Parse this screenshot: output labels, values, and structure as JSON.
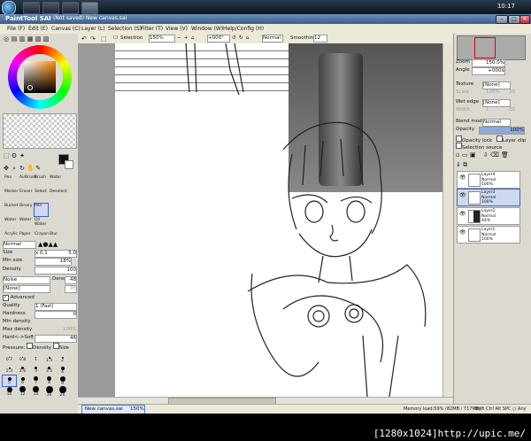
{
  "taskbar": {
    "clock": "10:17"
  },
  "window": {
    "app_title": "PaintTool SAI",
    "doc_title": "(Not saved) New canvas.sai"
  },
  "menu": [
    "File (F)",
    "Edit (E)",
    "Canvas (C)",
    "Layer (L)",
    "Selection (S)",
    "Filter (T)",
    "View (V)",
    "Window (W)",
    "Help/Config (H)"
  ],
  "toolbar": {
    "selection_label": "Selection",
    "zoom": "150%",
    "angle": "+000°",
    "blend": "Normal",
    "smoothing_label": "Smoothing",
    "smoothing": "12"
  },
  "brushes": [
    [
      "Pen",
      "AirBrush",
      "Brush",
      "Water"
    ],
    [
      "Marker",
      "Eraser",
      "Select",
      "Deselect"
    ],
    [
      "Bucket",
      "Binary",
      "Pen",
      ""
    ],
    [
      "Water",
      "Water",
      "Oil Water",
      ""
    ],
    [
      "Acrylic",
      "Paper",
      "Crayon",
      "Blur"
    ]
  ],
  "brush_props": {
    "mode": "Normal",
    "size_label": "Size",
    "size_mult": "x 0.1",
    "size_val": "5.0",
    "minsize_label": "Min size",
    "minsize_val": "18%",
    "density_label": "Density",
    "density_val": "100",
    "noise": "Noise",
    "noise_dens_label": "Dens",
    "noise_dens_val": "48",
    "none": "[None]",
    "none_val": "95",
    "advanced": "Advanced",
    "quality_label": "Quality",
    "quality_val": "1 (Fast)",
    "hardness_label": "Hardness",
    "hardness_val": "0",
    "mindensity_label": "Min density",
    "maxdensity_label": "Max density",
    "maxdensity_val": "100%",
    "hardsoft_label": "Hard<->Soft",
    "hardsoft_val": "46",
    "pressure_label": "Pressure:",
    "pressure_density": "Density",
    "pressure_size": "Size"
  },
  "sizes": [
    "0.7",
    "0.8",
    "1",
    "1.5",
    "2",
    "2.3",
    "2.6",
    "3",
    "3.5",
    "4",
    "5",
    "6",
    "7",
    "8",
    "9",
    "10",
    "12",
    "14",
    "16",
    "20"
  ],
  "navigator": {
    "zoom_label": "Zoom",
    "zoom_val": "150.0%",
    "angle_label": "Angle",
    "angle_val": "+000$"
  },
  "layer_props": {
    "texture_label": "Texture",
    "texture_val": "[None]",
    "scale_label": "Scale",
    "scale_val": "100%",
    "scale_num": "20",
    "wetedge_label": "Wet edge",
    "wetedge_val": "[None]",
    "width_label": "Width",
    "width_val": "1",
    "width_num": "20",
    "blend_label": "Blend mode",
    "blend_val": "Normal",
    "opacity_label": "Opacity",
    "opacity_val": "100%",
    "opacity_lock": "Opacity lock",
    "layer_clip": "Layer clip",
    "selection_source": "Selection source"
  },
  "layers": [
    {
      "name": "Layer4",
      "mode": "Normal",
      "opacity": "100%",
      "selected": false
    },
    {
      "name": "Layer3",
      "mode": "Normal",
      "opacity": "100%",
      "selected": true
    },
    {
      "name": "Layer2",
      "mode": "Normal",
      "opacity": "44%",
      "selected": false
    },
    {
      "name": "Layer1",
      "mode": "Normal",
      "opacity": "100%",
      "selected": false
    }
  ],
  "status": {
    "tab": "New canvas.sai",
    "tab_zoom": "150%",
    "memory": "Memory load:59% (82MB / 717MB)",
    "keys": "Shift Ctrl Alt SPC ○ Any"
  },
  "watermark": "[1280x1024]http://upic.me/"
}
